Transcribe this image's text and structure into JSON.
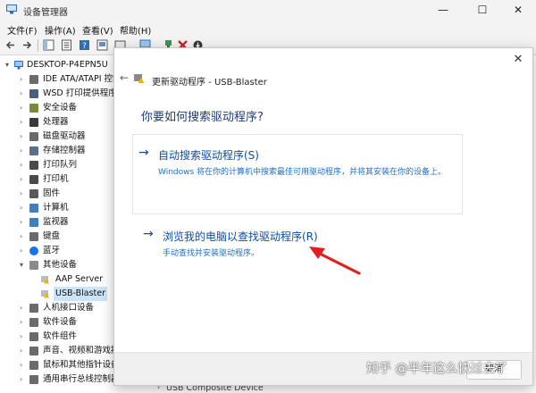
{
  "window": {
    "title": "设备管理器",
    "controls": {
      "minimize": "—",
      "maximize": "☐",
      "close": "✕"
    }
  },
  "menu": [
    "文件(F)",
    "操作(A)",
    "查看(V)",
    "帮助(H)"
  ],
  "tree": {
    "root": "DESKTOP-P4EPN5U",
    "items": [
      {
        "label": "IDE ATA/ATAPI 控制器",
        "color": "#6b6b6b"
      },
      {
        "label": "WSD 打印提供程序",
        "color": "#4a5f7a"
      },
      {
        "label": "安全设备",
        "color": "#7a8a3a"
      },
      {
        "label": "处理器",
        "color": "#3a3a3a"
      },
      {
        "label": "磁盘驱动器",
        "color": "#6b6b6b"
      },
      {
        "label": "存储控制器",
        "color": "#5a6f8a"
      },
      {
        "label": "打印队列",
        "color": "#4a4a4a"
      },
      {
        "label": "打印机",
        "color": "#4a4a4a"
      },
      {
        "label": "固件",
        "color": "#5a5a5a"
      },
      {
        "label": "计算机",
        "color": "#3f7fc0"
      },
      {
        "label": "监视器",
        "color": "#3f7fc0"
      },
      {
        "label": "键盘",
        "color": "#6b6b6b"
      },
      {
        "label": "蓝牙",
        "color": "#1a73e8"
      },
      {
        "label": "其他设备",
        "color": "#8a8a8a"
      }
    ],
    "children": [
      {
        "label": "AAP Server"
      },
      {
        "label": "USB-Blaster"
      }
    ],
    "more": [
      {
        "label": "人机接口设备",
        "color": "#6b6b6b"
      },
      {
        "label": "软件设备",
        "color": "#6b6b6b"
      },
      {
        "label": "软件组件",
        "color": "#6b6b6b"
      },
      {
        "label": "声音、视频和游戏控制器",
        "color": "#6b6b6b"
      },
      {
        "label": "鼠标和其他指针设备",
        "color": "#6b6b6b"
      },
      {
        "label": "通用串行总线控制器",
        "color": "#6b6b6b"
      }
    ],
    "bottom_item": "USB Composite Device"
  },
  "dialog": {
    "title": "更新驱动程序 - USB-Blaster",
    "heading": "你要如何搜索驱动程序?",
    "option1": {
      "title": "自动搜索驱动程序(S)",
      "desc": "Windows 将在你的计算机中搜索最佳可用驱动程序，并将其安装在你的设备上。"
    },
    "option2": {
      "title": "浏览我的电脑以查找驱动程序(R)",
      "desc": "手动查找并安装驱动程序。"
    },
    "footer_button": "取消"
  },
  "watermark": "知乎 @半年这么快过去了"
}
